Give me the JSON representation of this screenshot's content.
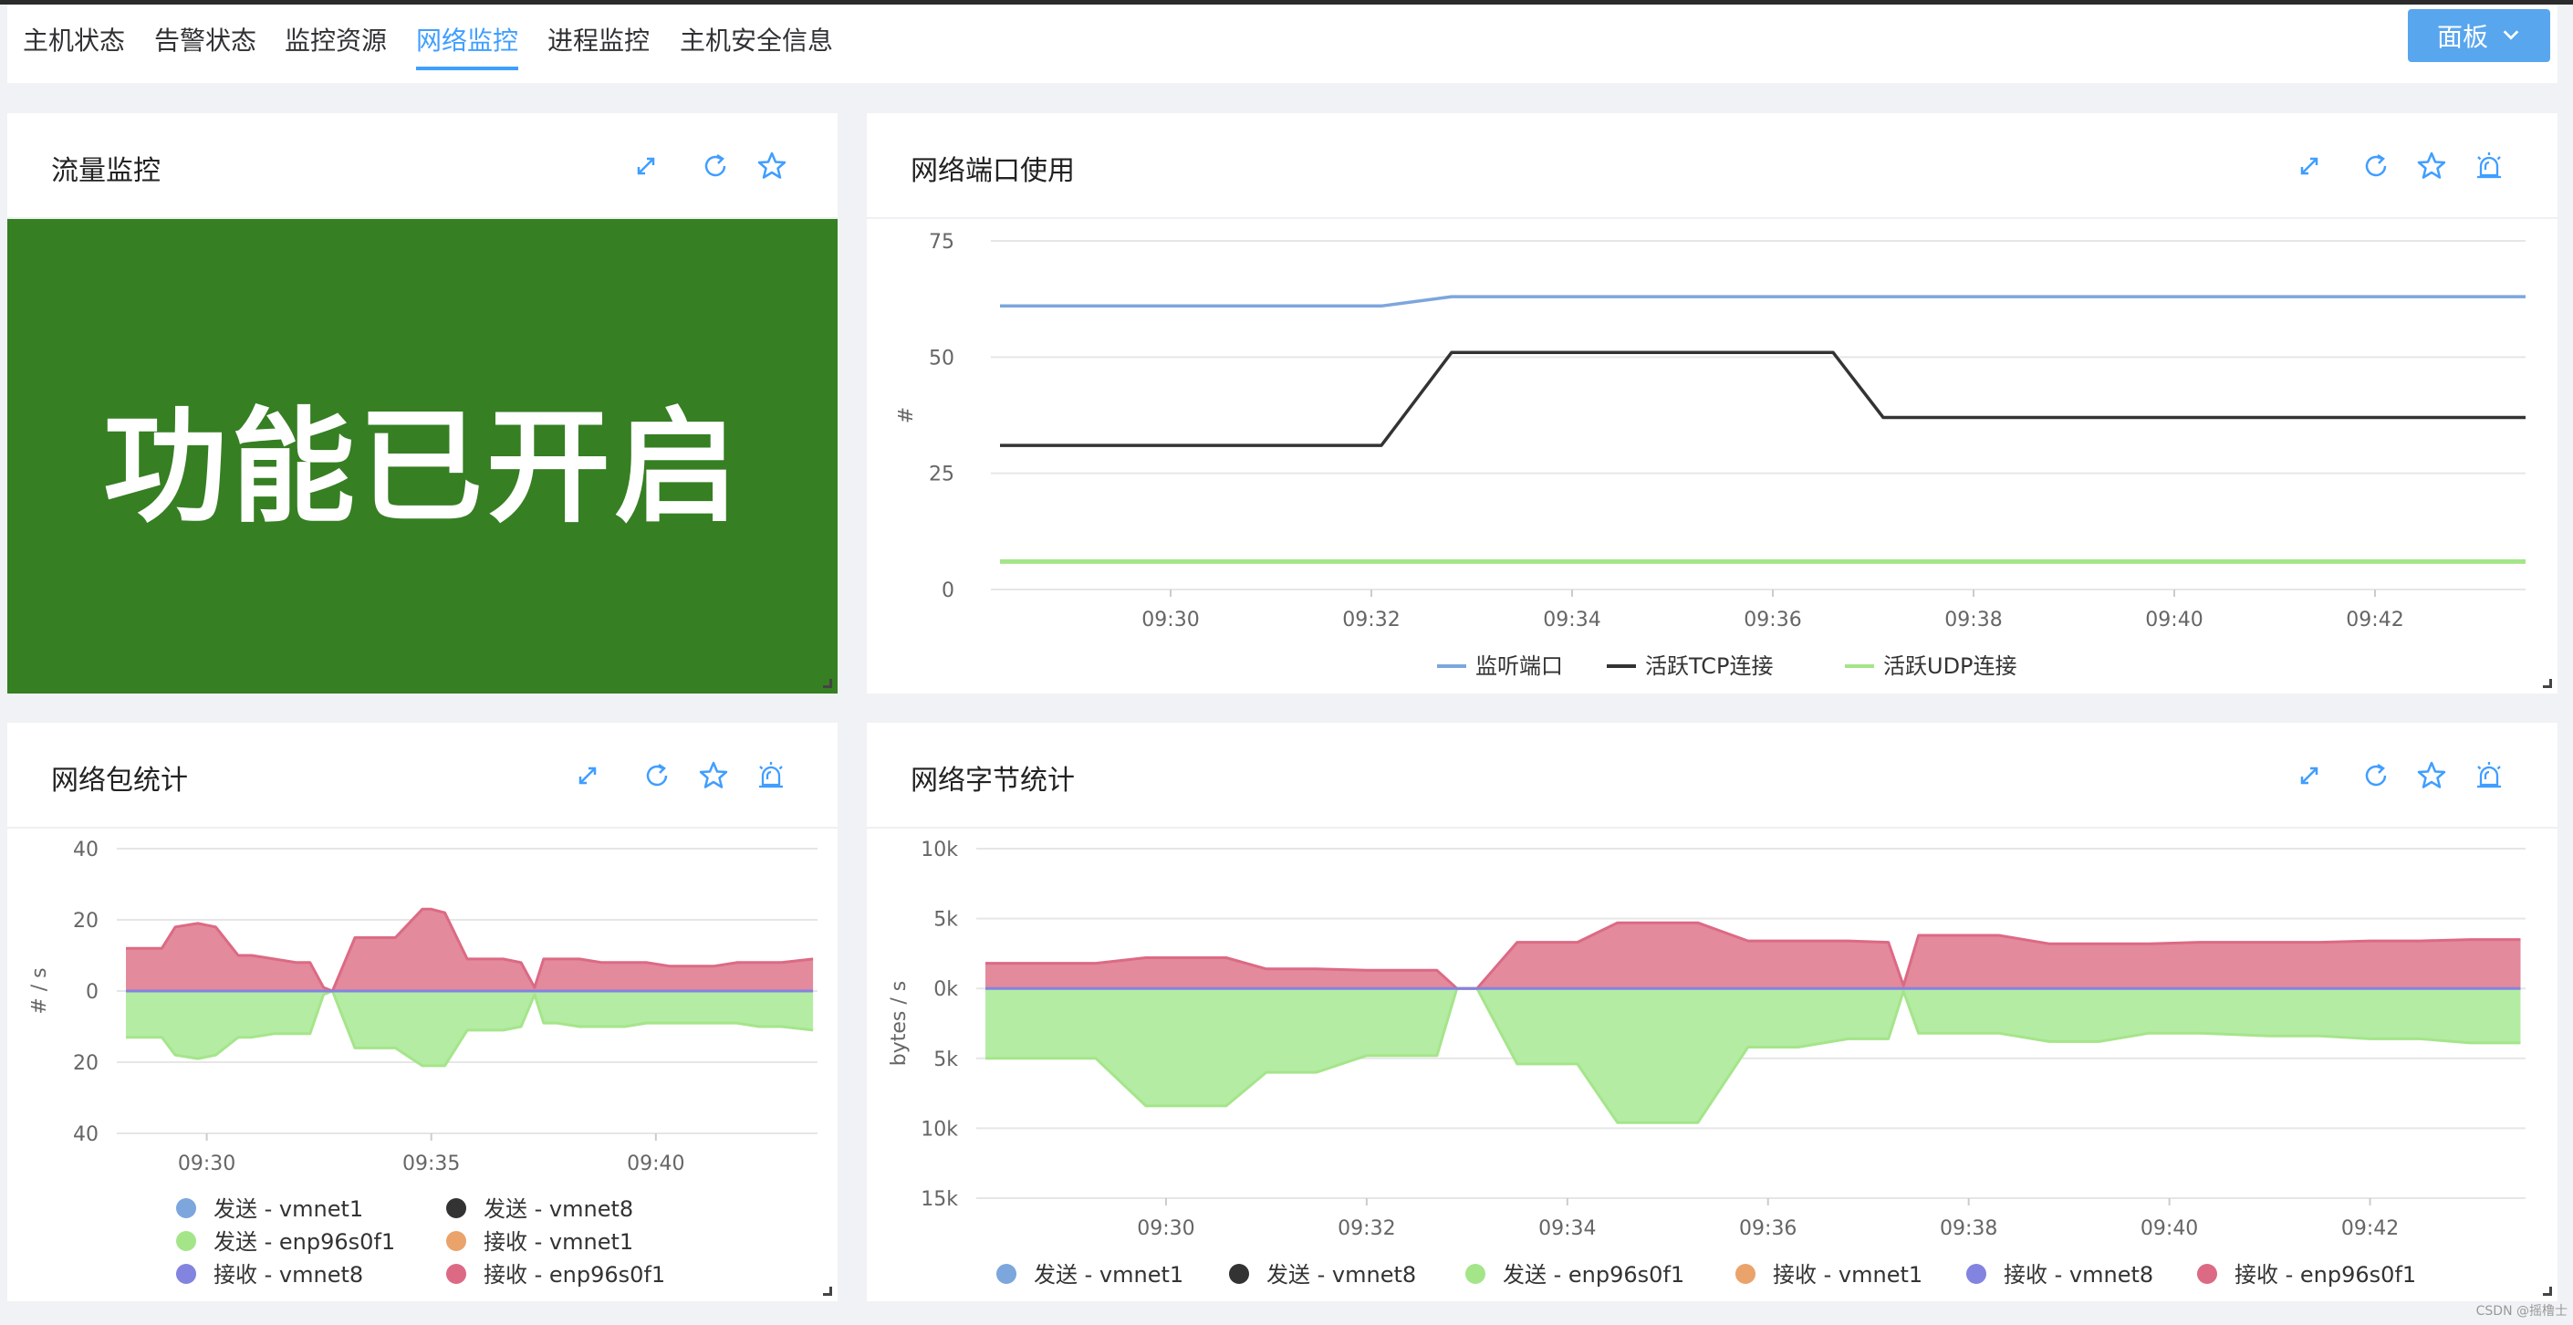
{
  "tabs": [
    {
      "label": "主机状态",
      "active": false
    },
    {
      "label": "告警状态",
      "active": false
    },
    {
      "label": "监控资源",
      "active": false
    },
    {
      "label": "网络监控",
      "active": true
    },
    {
      "label": "进程监控",
      "active": false
    },
    {
      "label": "主机安全信息",
      "active": false
    }
  ],
  "panel_button": {
    "label": "面板",
    "icon": "chevron-down-icon"
  },
  "cards": {
    "traffic": {
      "title": "流量监控",
      "banner_text": "功能已开启",
      "banner_color": "#367f23"
    },
    "ports": {
      "title": "网络端口使用"
    },
    "packets": {
      "title": "网络包统计"
    },
    "bytes": {
      "title": "网络字节统计"
    }
  },
  "tools": [
    "expand-icon",
    "refresh-icon",
    "star-icon",
    "alarm-icon"
  ],
  "watermark": "CSDN @摇橹士",
  "colors": {
    "accent": "#409eff",
    "series_blue": "#7ca6dc",
    "series_dark": "#333333",
    "series_green": "#a5e58a",
    "series_orange": "#eaa36b",
    "series_purple": "#8383e0",
    "series_red": "#dc6a84",
    "fill_red": "#e38a9c",
    "fill_green": "#b4eca4"
  },
  "chart_data": [
    {
      "id": "ports",
      "type": "line",
      "ylabel": "#",
      "ylim": [
        0,
        75
      ],
      "yticks": [
        "0",
        "25",
        "50",
        "75"
      ],
      "xtick_labels": [
        "09:30",
        "09:32",
        "09:34",
        "09:36",
        "09:38",
        "09:40",
        "09:42"
      ],
      "x": [
        "09:28.3",
        "09:32.1",
        "09:32.8",
        "09:36.6",
        "09:37.1",
        "09:43.5"
      ],
      "series": [
        {
          "name": "监听端口",
          "color": "#7ca6dc",
          "values": [
            61,
            61,
            63,
            63,
            63,
            63
          ]
        },
        {
          "name": "活跃TCP连接",
          "color": "#333333",
          "values": [
            31,
            31,
            51,
            51,
            37,
            37
          ]
        },
        {
          "name": "活跃UDP连接",
          "color": "#a5e58a",
          "values": [
            6,
            6,
            6,
            6,
            6,
            6
          ]
        }
      ],
      "legend_position": "bottom"
    },
    {
      "id": "packets",
      "type": "area",
      "ylabel": "# / s",
      "yticks": [
        "40",
        "20",
        "0",
        "20",
        "40"
      ],
      "ylim": [
        -40,
        40
      ],
      "xtick_labels": [
        "09:30",
        "09:35",
        "09:40"
      ],
      "x_minutes": [
        28.2,
        29.0,
        29.3,
        29.8,
        30.2,
        30.7,
        31.0,
        31.5,
        32.0,
        32.3,
        32.6,
        32.8,
        33.3,
        33.7,
        34.2,
        34.8,
        35.0,
        35.3,
        35.8,
        36.2,
        36.6,
        37.0,
        37.3,
        37.5,
        37.8,
        38.3,
        38.8,
        39.3,
        39.8,
        40.3,
        40.8,
        41.3,
        41.8,
        42.3,
        42.8,
        43.5
      ],
      "series": [
        {
          "name": "发送 - vmnet1",
          "color": "#7ca6dc",
          "values": []
        },
        {
          "name": "发送 - vmnet8",
          "color": "#333333",
          "values": []
        },
        {
          "name": "发送 - enp96s0f1",
          "color": "#a5e58a",
          "values": [
            -13,
            -13,
            -18,
            -19,
            -18,
            -13,
            -13,
            -12,
            -12,
            -12,
            -1,
            0,
            -16,
            -16,
            -16,
            -21,
            -21,
            -21,
            -11,
            -11,
            -11,
            -10,
            -1,
            -9,
            -9,
            -10,
            -10,
            -10,
            -9,
            -9,
            -9,
            -9,
            -9,
            -10,
            -10,
            -11
          ]
        },
        {
          "name": "接收 - vmnet1",
          "color": "#eaa36b",
          "values": []
        },
        {
          "name": "接收 - vmnet8",
          "color": "#8383e0",
          "values": []
        },
        {
          "name": "接收 - enp96s0f1",
          "color": "#dc6a84",
          "values": [
            12,
            12,
            18,
            19,
            18,
            10,
            10,
            9,
            8,
            8,
            1,
            0,
            15,
            15,
            15,
            23,
            23,
            22,
            9,
            9,
            9,
            8,
            1,
            9,
            9,
            9,
            8,
            8,
            8,
            7,
            7,
            7,
            8,
            8,
            8,
            9
          ]
        }
      ],
      "legend_position": "bottom"
    },
    {
      "id": "bytes",
      "type": "area",
      "ylabel": "bytes / s",
      "yticks": [
        "10k",
        "5k",
        "0k",
        "5k",
        "10k",
        "15k"
      ],
      "ylim": [
        -15000,
        10000
      ],
      "xtick_labels": [
        "09:30",
        "09:32",
        "09:34",
        "09:36",
        "09:38",
        "09:40",
        "09:42"
      ],
      "x_minutes": [
        28.2,
        28.8,
        29.3,
        29.8,
        30.2,
        30.6,
        31.0,
        31.5,
        32.0,
        32.5,
        32.7,
        32.9,
        33.1,
        33.5,
        33.9,
        34.1,
        34.5,
        34.9,
        35.3,
        35.8,
        36.3,
        36.8,
        37.2,
        37.35,
        37.5,
        38.0,
        38.3,
        38.8,
        39.3,
        39.8,
        40.3,
        41.0,
        41.5,
        42.0,
        42.5,
        43.0,
        43.5
      ],
      "series": [
        {
          "name": "发送 - vmnet1",
          "color": "#7ca6dc",
          "values": []
        },
        {
          "name": "发送 - vmnet8",
          "color": "#333333",
          "values": []
        },
        {
          "name": "发送 - enp96s0f1",
          "color": "#a5e58a",
          "values": [
            -5000,
            -5000,
            -5000,
            -8400,
            -8400,
            -8400,
            -6000,
            -6000,
            -4800,
            -4800,
            -4800,
            0,
            0,
            -5400,
            -5400,
            -5400,
            -9600,
            -9600,
            -9600,
            -4200,
            -4200,
            -3600,
            -3600,
            -200,
            -3200,
            -3200,
            -3200,
            -3800,
            -3800,
            -3200,
            -3200,
            -3400,
            -3400,
            -3600,
            -3600,
            -3900,
            -3900
          ]
        },
        {
          "name": "接收 - vmnet1",
          "color": "#eaa36b",
          "values": []
        },
        {
          "name": "接收 - vmnet8",
          "color": "#8383e0",
          "values": []
        },
        {
          "name": "接收 - enp96s0f1",
          "color": "#dc6a84",
          "values": [
            1800,
            1800,
            1800,
            2200,
            2200,
            2200,
            1400,
            1400,
            1300,
            1300,
            1300,
            0,
            0,
            3300,
            3300,
            3300,
            4700,
            4700,
            4700,
            3400,
            3400,
            3400,
            3300,
            200,
            3800,
            3800,
            3800,
            3200,
            3200,
            3200,
            3300,
            3300,
            3300,
            3400,
            3400,
            3500,
            3500
          ]
        }
      ],
      "legend_position": "bottom"
    }
  ]
}
